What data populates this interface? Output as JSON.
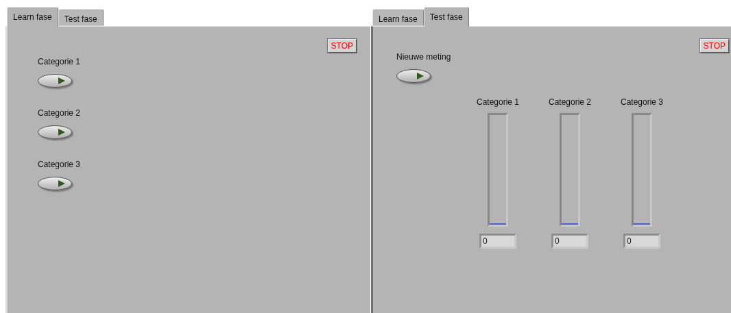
{
  "panels": [
    {
      "tabs": [
        {
          "label": "Learn fase",
          "selected": true
        },
        {
          "label": "Test fase",
          "selected": false
        }
      ],
      "stop_button": "STOP",
      "buttons": [
        {
          "label": "Categorie 1",
          "on": false
        },
        {
          "label": "Categorie 2",
          "on": false
        },
        {
          "label": "Categorie 3",
          "on": false
        }
      ]
    },
    {
      "tabs": [
        {
          "label": "Learn fase",
          "selected": false
        },
        {
          "label": "Test fase",
          "selected": true
        }
      ],
      "stop_button": "STOP",
      "buttons": [
        {
          "label": "Nieuwe meting",
          "on": false
        }
      ],
      "meters": [
        {
          "label": "Categorie 1",
          "level": 0,
          "reading": "0"
        },
        {
          "label": "Categorie 2",
          "level": 0,
          "reading": "0"
        },
        {
          "label": "Categorie 3",
          "level": 0,
          "reading": "0"
        }
      ]
    }
  ]
}
